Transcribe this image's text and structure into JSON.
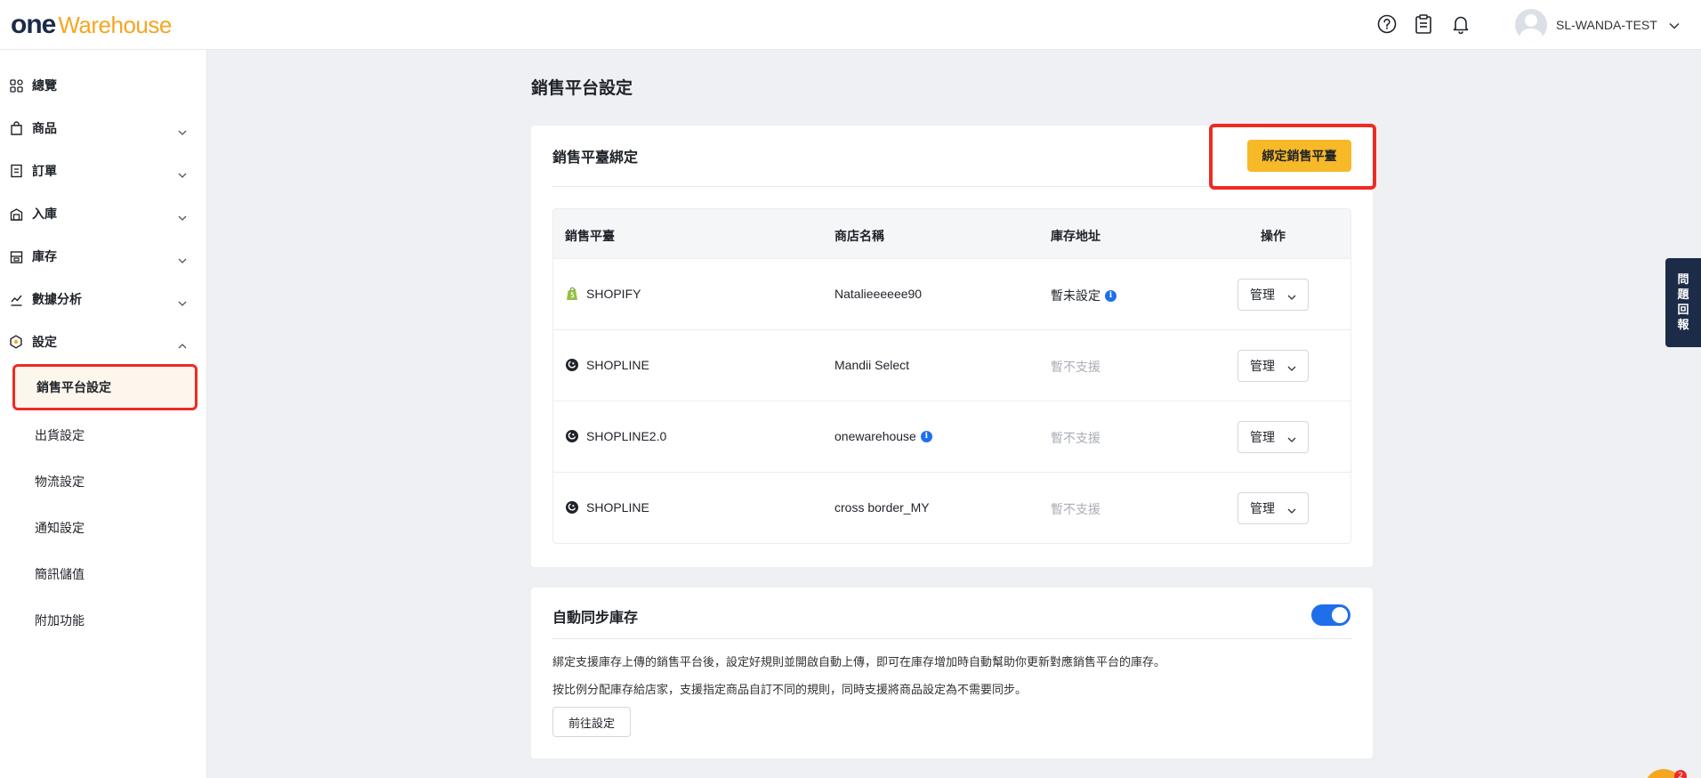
{
  "header": {
    "logo_one": "one",
    "logo_warehouse": "Warehouse",
    "user_name": "SL-WANDA-TEST",
    "icons": [
      "help-icon",
      "clipboard-icon",
      "bell-icon",
      "avatar",
      "chevron-down-icon"
    ]
  },
  "sidebar": {
    "items": [
      {
        "label": "總覽",
        "icon": "dashboard-icon"
      },
      {
        "label": "商品",
        "icon": "bag-icon"
      },
      {
        "label": "訂單",
        "icon": "order-icon"
      },
      {
        "label": "入庫",
        "icon": "inbound-icon"
      },
      {
        "label": "庫存",
        "icon": "inventory-icon"
      },
      {
        "label": "數據分析",
        "icon": "analytics-icon"
      },
      {
        "label": "設定",
        "icon": "settings-icon"
      }
    ],
    "sub_items": [
      {
        "label": "銷售平台設定",
        "active": true
      },
      {
        "label": "出貨設定"
      },
      {
        "label": "物流設定"
      },
      {
        "label": "通知設定"
      },
      {
        "label": "簡訊儲值"
      },
      {
        "label": "附加功能"
      }
    ]
  },
  "main": {
    "page_title": "銷售平台設定",
    "binding_card": {
      "title": "銷售平臺綁定",
      "bind_button": "綁定銷售平臺",
      "columns": [
        "銷售平臺",
        "商店名稱",
        "庫存地址",
        "操作"
      ],
      "rows": [
        {
          "platform": "SHOPIFY",
          "platform_icon": "shopify-icon",
          "store": "Natalieeeeee90",
          "store_info": false,
          "address": "暫未設定",
          "address_info": true,
          "address_muted": false,
          "action": "管理"
        },
        {
          "platform": "SHOPLINE",
          "platform_icon": "shopline-icon",
          "store": "Mandii Select",
          "store_info": false,
          "address": "暫不支援",
          "address_info": false,
          "address_muted": true,
          "action": "管理"
        },
        {
          "platform": "SHOPLINE2.0",
          "platform_icon": "shopline-icon",
          "store": "onewarehouse",
          "store_info": true,
          "address": "暫不支援",
          "address_info": false,
          "address_muted": true,
          "action": "管理"
        },
        {
          "platform": "SHOPLINE",
          "platform_icon": "shopline-icon",
          "store": "cross border_MY",
          "store_info": false,
          "address": "暫不支援",
          "address_info": false,
          "address_muted": true,
          "action": "管理"
        }
      ]
    },
    "sync_card": {
      "title": "自動同步庫存",
      "toggle_on": true,
      "desc1": "綁定支援庫存上傳的銷售平台後，設定好規則並開啟自動上傳，即可在庫存增加時自動幫助你更新對應銷售平台的庫存。",
      "desc2": "按比例分配庫存給店家，支援指定商品自訂不同的規則，同時支援將商品設定為不需要同步。",
      "goto_button": "前往設定"
    }
  },
  "feedback": {
    "label": "問題回報",
    "chars": [
      "問",
      "題",
      "回",
      "報"
    ]
  },
  "chat": {
    "badge": "2"
  },
  "colors": {
    "accent": "#f7b928",
    "brand_navy": "#1b2b48",
    "highlight": "#ee2b22",
    "toggle": "#1f6feb"
  }
}
